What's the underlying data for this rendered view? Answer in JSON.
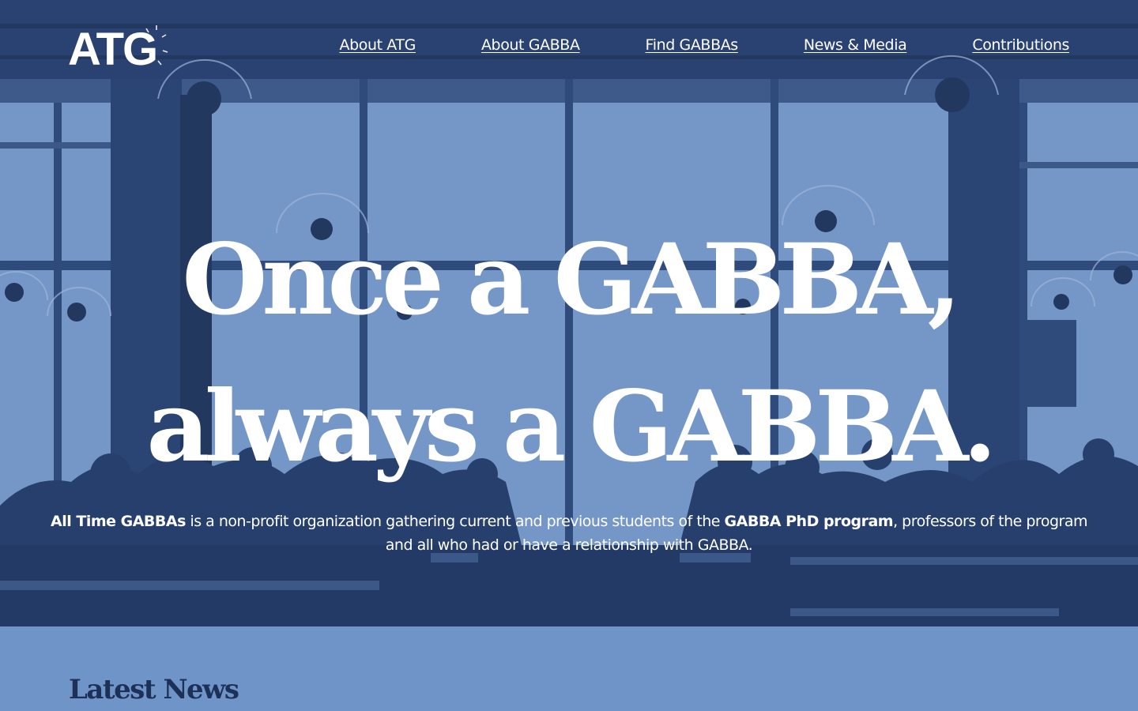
{
  "header": {
    "logo_text": "ATG",
    "nav": [
      {
        "label": "About ATG"
      },
      {
        "label": "About GABBA"
      },
      {
        "label": "Find GABBAs"
      },
      {
        "label": "News & Media"
      },
      {
        "label": "Contributions"
      }
    ]
  },
  "hero": {
    "headline_line1": "Once a GABBA,",
    "headline_line2": "always a GABBA.",
    "tagline": {
      "org_name": "All Time GABBAs",
      "text1": " is a non-profit organization gathering current and previous students of the ",
      "program_name": "GABBA PhD program",
      "text2": ", professors of the program and all who had or have a relationship with GABBA."
    }
  },
  "news": {
    "heading": "Latest News"
  },
  "colors": {
    "hero_dark": "#233a66",
    "hero_light": "#7295c6",
    "news_bg": "#6f94c8",
    "news_heading": "#1d3157",
    "text_white": "#ffffff"
  }
}
